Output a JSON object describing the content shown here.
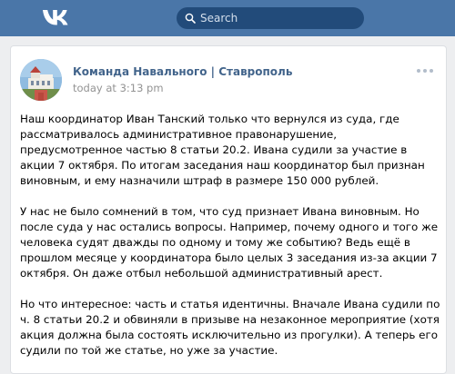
{
  "header": {
    "logo_icon": "vk-logo-icon",
    "search_placeholder": "Search",
    "bar_color": "#4a76a8"
  },
  "post": {
    "author": "Команда Навального | Ставрополь",
    "timestamp": "today at 3:13 pm",
    "more_icon": "more-icon",
    "paragraphs": [
      "Наш координатор Иван Танский только что вернулся из суда, где рассматривалось административное правонарушение, предусмотренное частью 8 статьи 20.2. Ивана судили за участие в акции 7 октября. По итогам заседания наш координатор был признан виновным, и ему назначили штраф в размере 150 000 рублей.",
      "У нас не было сомнений в том, что суд признает Ивана виновным. Но после суда у нас остались вопросы. Например, почему одного и того же человека судят дважды по одному и тому же событию? Ведь ещё в прошлом месяце у координатора было целых 3 заседания из-за акции 7 октября. Он даже отбыл небольшой административный арест.",
      "Но что интересное: часть и статья идентичны. Вначале Ивана судили по ч. 8 статьи 20.2 и обвиняли в призыве на незаконное мероприятие (хотя акция должна была состоять исключительно из прогулки). А теперь его судили по той же статье, но уже за участие."
    ]
  }
}
